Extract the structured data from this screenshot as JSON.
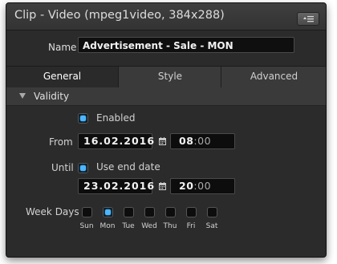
{
  "window": {
    "title": "Clip - Video (mpeg1video, 384x288)"
  },
  "name": {
    "label": "Name",
    "value": "Advertisement - Sale - MON"
  },
  "tabs": [
    {
      "label": "General",
      "active": true
    },
    {
      "label": "Style",
      "active": false
    },
    {
      "label": "Advanced",
      "active": false
    }
  ],
  "validity": {
    "section_label": "Validity",
    "enabled": {
      "label": "Enabled",
      "checked": true
    },
    "from": {
      "label": "From",
      "date": "16.02.2016",
      "time_hour": "08",
      "time_min": ":00"
    },
    "until": {
      "label": "Until",
      "use_end_date": {
        "label": "Use end date",
        "checked": true
      },
      "date": "23.02.2016",
      "time_hour": "20",
      "time_min": ":00"
    },
    "week_days": {
      "label": "Week Days",
      "days": [
        {
          "label": "Sun",
          "checked": false
        },
        {
          "label": "Mon",
          "checked": true
        },
        {
          "label": "Tue",
          "checked": false
        },
        {
          "label": "Wed",
          "checked": false
        },
        {
          "label": "Thu",
          "checked": false
        },
        {
          "label": "Fri",
          "checked": false
        },
        {
          "label": "Sat",
          "checked": false
        }
      ]
    }
  },
  "icons": {
    "menu": "menu-list-icon",
    "collapse": "triangle-down-icon",
    "calendar": "calendar-icon"
  },
  "colors": {
    "accent": "#4db6ff",
    "panel_bg": "#2b2b2b",
    "field_bg": "#0d0d0d"
  }
}
